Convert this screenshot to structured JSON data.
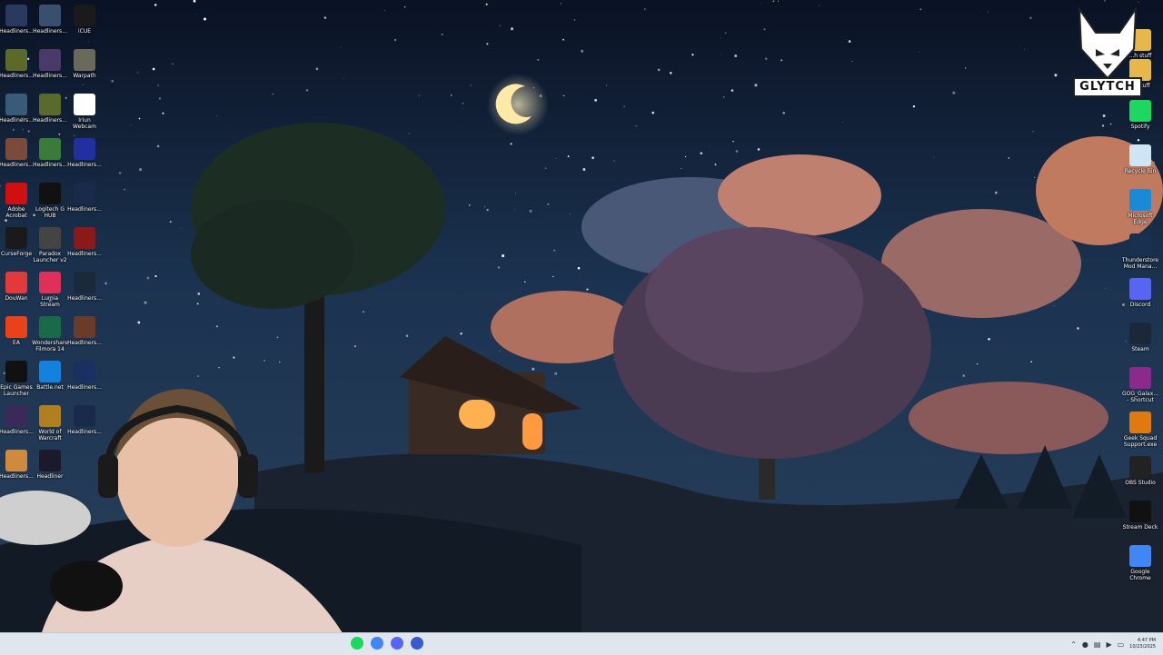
{
  "desktop": {
    "left_icons": [
      {
        "label": "Headliners...",
        "icon": "game-thumbnail-icon",
        "color": "#2a3a5e"
      },
      {
        "label": "Headliners...",
        "icon": "game-thumbnail-icon",
        "color": "#3a4e6e"
      },
      {
        "label": "iCUE",
        "icon": "icue-icon",
        "color": "#1a1a1a"
      },
      {
        "label": "Headliners...",
        "icon": "game-thumbnail-icon",
        "color": "#5b6a2a"
      },
      {
        "label": "Headliners...",
        "icon": "game-thumbnail-icon",
        "color": "#4a3a6a"
      },
      {
        "label": "Warpath",
        "icon": "warpath-icon",
        "color": "#6a6a5a"
      },
      {
        "label": "Headliners...",
        "icon": "game-thumbnail-icon",
        "color": "#3a5a7a"
      },
      {
        "label": "Headliners...",
        "icon": "game-thumbnail-icon",
        "color": "#5a6a2a"
      },
      {
        "label": "Iriun\nWebcam",
        "icon": "iriun-webcam-icon",
        "color": "#ffffff"
      },
      {
        "label": "Headliners...",
        "icon": "game-thumbnail-icon",
        "color": "#7a4a3a"
      },
      {
        "label": "Headliners...",
        "icon": "game-thumbnail-icon",
        "color": "#3a7a3a"
      },
      {
        "label": "Headliners...",
        "icon": "game-thumbnail-icon",
        "color": "#2030a0"
      },
      {
        "label": "Adobe\nAcrobat",
        "icon": "adobe-acrobat-icon",
        "color": "#d01010"
      },
      {
        "label": "Logitech G\nHUB",
        "icon": "logitech-icon",
        "color": "#111111"
      },
      {
        "label": "Headliners...",
        "icon": "game-thumbnail-icon",
        "color": "#1a2a4a"
      },
      {
        "label": "CurseForge",
        "icon": "curseforge-icon",
        "color": "#1a1a1a"
      },
      {
        "label": "Paradox\nLauncher v2",
        "icon": "paradox-icon",
        "color": "#444444"
      },
      {
        "label": "Headliners...",
        "icon": "game-thumbnail-icon",
        "color": "#8a1a1a"
      },
      {
        "label": "DouWan",
        "icon": "douwan-icon",
        "color": "#e23a3a"
      },
      {
        "label": "Lumia\nStream",
        "icon": "lumia-stream-icon",
        "color": "#e0305a"
      },
      {
        "label": "Headliners...",
        "icon": "game-thumbnail-icon",
        "color": "#1a2a3a"
      },
      {
        "label": "EA",
        "icon": "ea-icon",
        "color": "#e8421a"
      },
      {
        "label": "Wondershare\nFilmora 14",
        "icon": "filmora-icon",
        "color": "#1a6a4a"
      },
      {
        "label": "Headliners...",
        "icon": "game-thumbnail-icon",
        "color": "#6a3a2a"
      },
      {
        "label": "Epic Games\nLauncher",
        "icon": "epic-games-icon",
        "color": "#111111"
      },
      {
        "label": "Battle.net",
        "icon": "battlenet-icon",
        "color": "#1480e0"
      },
      {
        "label": "Headliners...",
        "icon": "game-thumbnail-icon",
        "color": "#1a3060"
      },
      {
        "label": "Headliners...",
        "icon": "game-thumbnail-icon",
        "color": "#3a2a5a"
      },
      {
        "label": "World of\nWarcraft",
        "icon": "world-of-warcraft-icon",
        "color": "#b08020"
      },
      {
        "label": "Headliners...",
        "icon": "game-thumbnail-icon",
        "color": "#1a2a4a"
      },
      {
        "label": "Headliners...",
        "icon": "game-thumbnail-icon",
        "color": "#d08a40"
      },
      {
        "label": "Headliner",
        "icon": "game-thumbnail-icon",
        "color": "#1a1a2a"
      }
    ],
    "right_icons": [
      {
        "label": "...h stuff",
        "icon": "folder-icon",
        "color": "#e6b84a"
      },
      {
        "label": "... stuff",
        "icon": "folder-icon",
        "color": "#e6b84a"
      },
      {
        "label": "Spotify",
        "icon": "spotify-icon",
        "color": "#1ed760"
      },
      {
        "label": "Recycle Bin",
        "icon": "recycle-bin-icon",
        "color": "#cfe4f5"
      },
      {
        "label": "Microsoft\nEdge",
        "icon": "edge-icon",
        "color": "#1a8ad8"
      },
      {
        "label": "Thunderstore\nMod Mana...",
        "icon": "thunderstore-icon",
        "color": "#1a3050"
      },
      {
        "label": "Discord",
        "icon": "discord-icon",
        "color": "#5865f2"
      },
      {
        "label": "Steam",
        "icon": "steam-icon",
        "color": "#1b2838"
      },
      {
        "label": "GOG_Galax...\n- Shortcut",
        "icon": "gog-galaxy-icon",
        "color": "#8a2a8a"
      },
      {
        "label": "Geek Squad\nSupport.exe",
        "icon": "geek-squad-icon",
        "color": "#e07a10"
      },
      {
        "label": "OBS Studio",
        "icon": "obs-studio-icon",
        "color": "#222222"
      },
      {
        "label": "Stream Deck",
        "icon": "stream-deck-icon",
        "color": "#111111"
      },
      {
        "label": "Google\nChrome",
        "icon": "chrome-icon",
        "color": "#4285f4"
      }
    ],
    "logo_text": "GLYTCH"
  },
  "taskbar": {
    "apps": [
      {
        "icon": "spotify-taskbar-icon",
        "color": "#1ed760"
      },
      {
        "icon": "chrome-taskbar-icon",
        "color": "#4285f4"
      },
      {
        "icon": "discord-taskbar-icon",
        "color": "#5865f2"
      },
      {
        "icon": "app-taskbar-icon",
        "color": "#3a5acc"
      }
    ],
    "time": "4:47 PM",
    "date": "10/23/2025"
  }
}
